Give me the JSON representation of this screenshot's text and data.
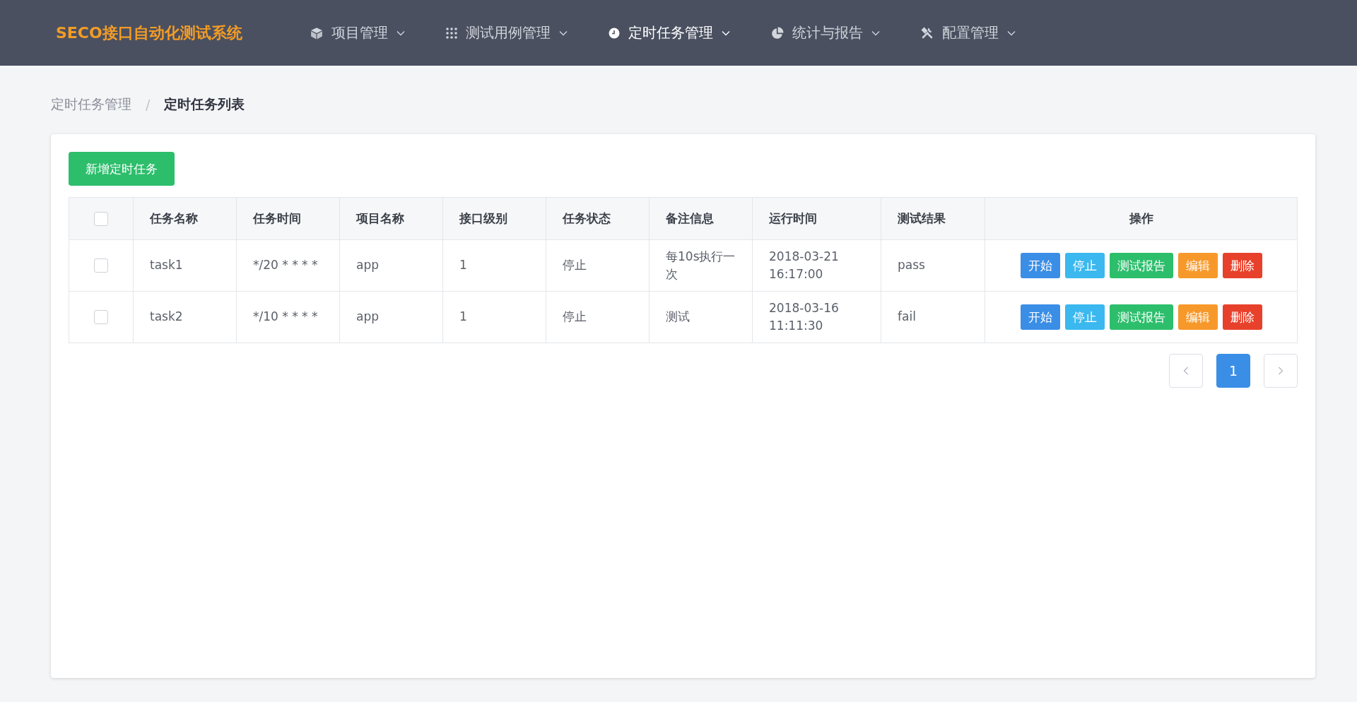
{
  "app_title": "SECO接口自动化测试系统",
  "nav": [
    {
      "label": "项目管理",
      "selected": false
    },
    {
      "label": "测试用例管理",
      "selected": false
    },
    {
      "label": "定时任务管理",
      "selected": true
    },
    {
      "label": "统计与报告",
      "selected": false
    },
    {
      "label": "配置管理",
      "selected": false
    }
  ],
  "breadcrumb": [
    "定时任务管理",
    "定时任务列表"
  ],
  "breadcrumb_separator": "/",
  "add_button": "新增定时任务",
  "table": {
    "select_all_checked": false,
    "columns": [
      "任务名称",
      "任务时间",
      "项目名称",
      "接口级别",
      "任务状态",
      "备注信息",
      "运行时间",
      "测试结果",
      "操作"
    ],
    "rows": [
      {
        "checked": false,
        "cells": [
          "task1",
          "*/20 * * * *",
          "app",
          "1",
          "停止",
          "每10s执行一次",
          "2018-03-21 16:17:00",
          "pass"
        ],
        "actions": [
          {
            "label": "开始",
            "kind": "primary"
          },
          {
            "label": "停止",
            "kind": "info"
          },
          {
            "label": "测试报告",
            "kind": "success"
          },
          {
            "label": "编辑",
            "kind": "warning"
          },
          {
            "label": "删除",
            "kind": "danger"
          }
        ]
      },
      {
        "checked": false,
        "cells": [
          "task2",
          "*/10 * * * *",
          "app",
          "1",
          "停止",
          "测试",
          "2018-03-16 11:11:30",
          "fail"
        ],
        "actions": [
          {
            "label": "开始",
            "kind": "primary"
          },
          {
            "label": "停止",
            "kind": "info"
          },
          {
            "label": "测试报告",
            "kind": "success"
          },
          {
            "label": "编辑",
            "kind": "warning"
          },
          {
            "label": "删除",
            "kind": "danger"
          }
        ]
      }
    ]
  },
  "pagination": {
    "pages": [
      {
        "label": "1",
        "selected": true
      }
    ]
  }
}
